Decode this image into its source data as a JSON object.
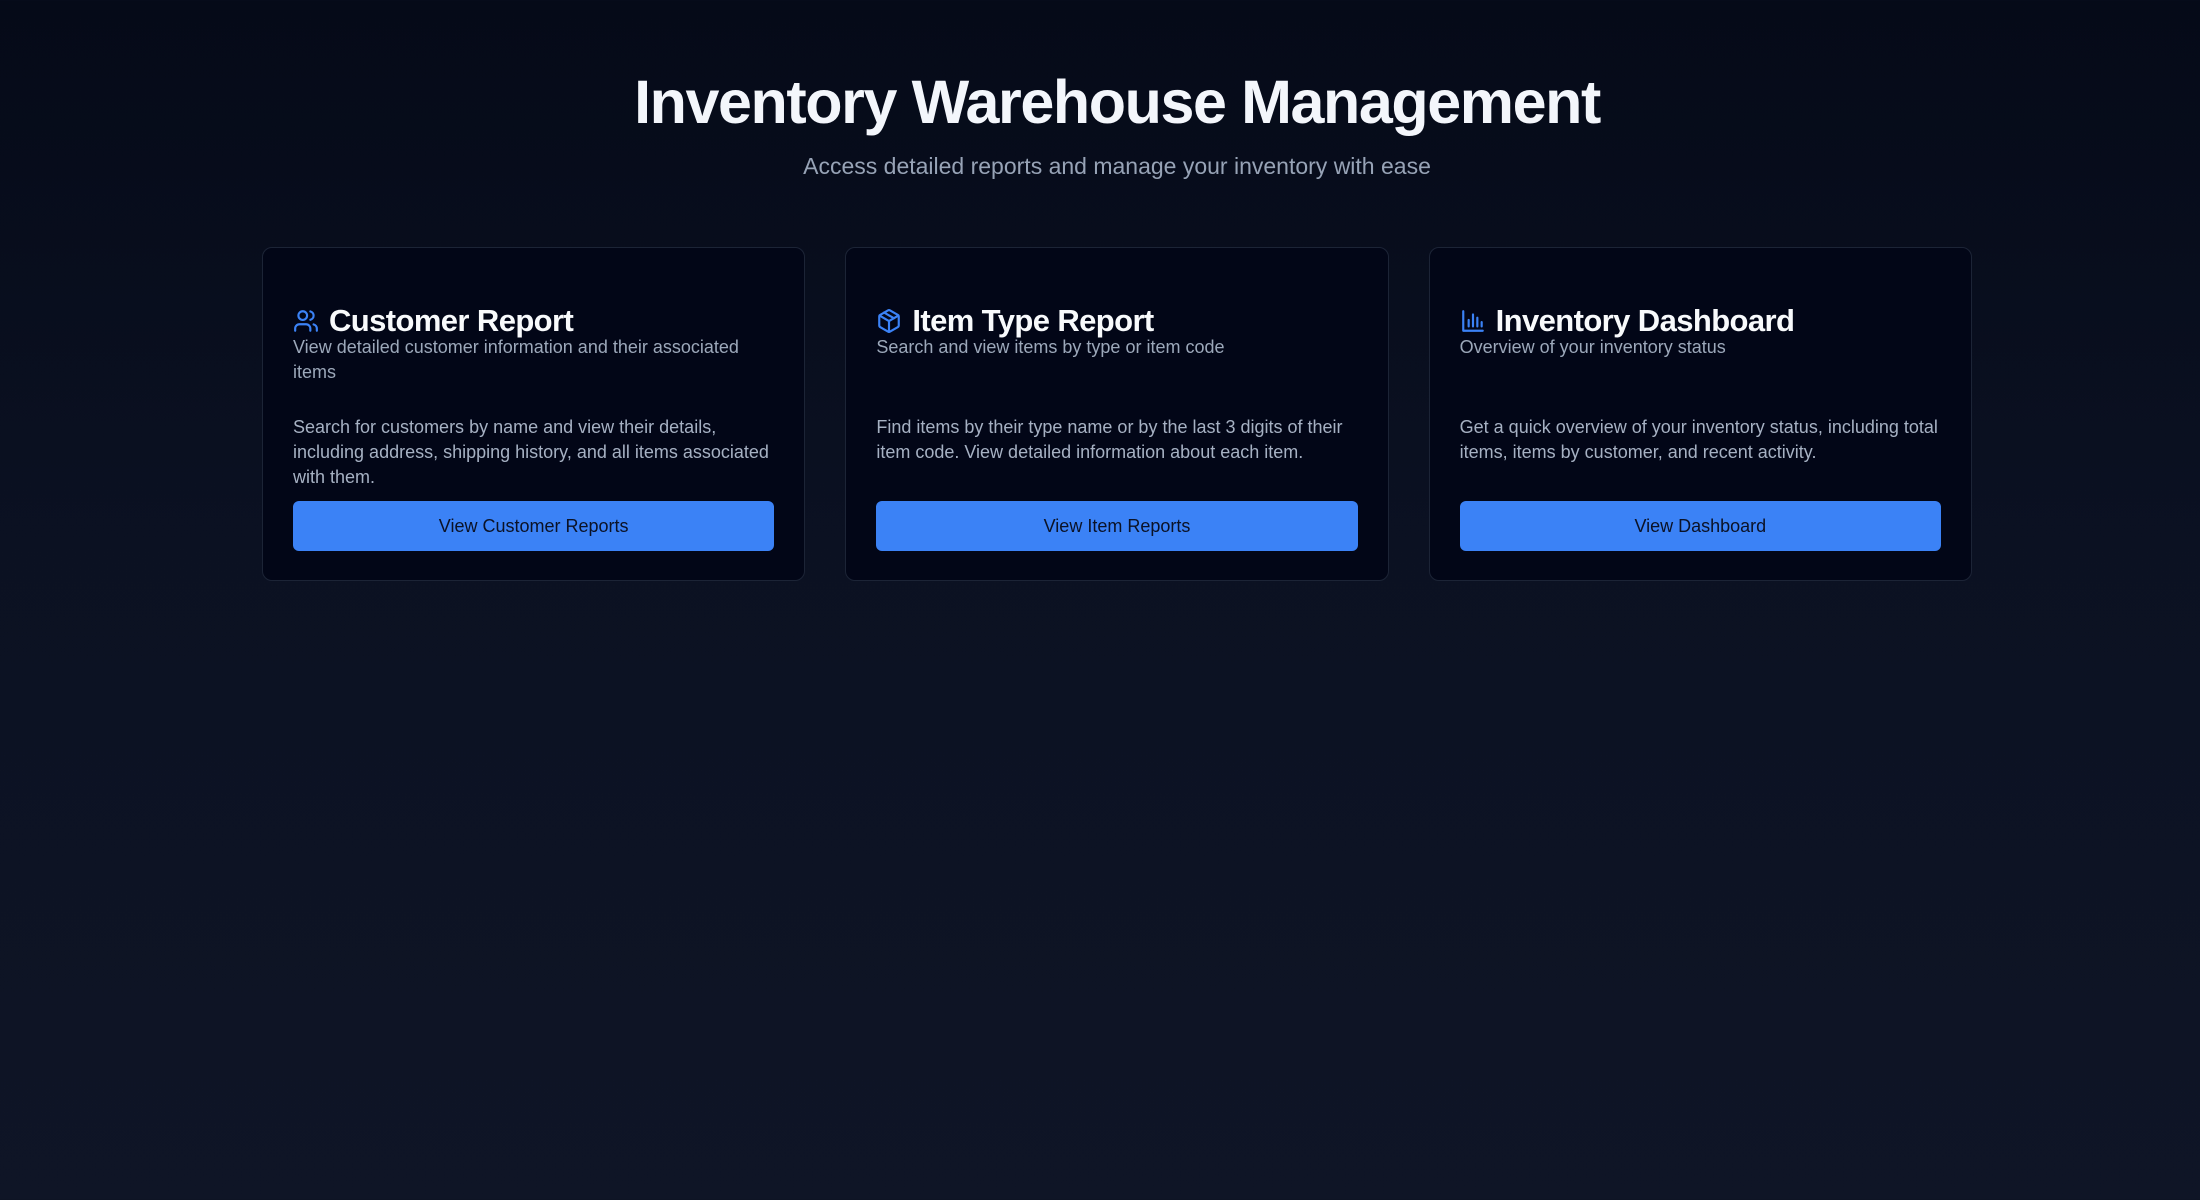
{
  "header": {
    "title": "Inventory Warehouse Management",
    "subtitle": "Access detailed reports and manage your inventory with ease"
  },
  "colors": {
    "background": "#050a18",
    "card_background": "#020617",
    "card_border": "#1c2436",
    "accent": "#3b82f6",
    "text_primary": "#f8fafc",
    "text_secondary": "#97a3b6"
  },
  "cards": [
    {
      "icon": "users-icon",
      "title": "Customer Report",
      "description": "View detailed customer information and their associated items",
      "body": "Search for customers by name and view their details, including address, shipping history, and all items associated with them.",
      "button_label": "View Customer Reports"
    },
    {
      "icon": "package-icon",
      "title": "Item Type Report",
      "description": "Search and view items by type or item code",
      "body": "Find items by their type name or by the last 3 digits of their item code. View detailed information about each item.",
      "button_label": "View Item Reports"
    },
    {
      "icon": "bar-chart-icon",
      "title": "Inventory Dashboard",
      "description": "Overview of your inventory status",
      "body": "Get a quick overview of your inventory status, including total items, items by customer, and recent activity.",
      "button_label": "View Dashboard"
    }
  ]
}
